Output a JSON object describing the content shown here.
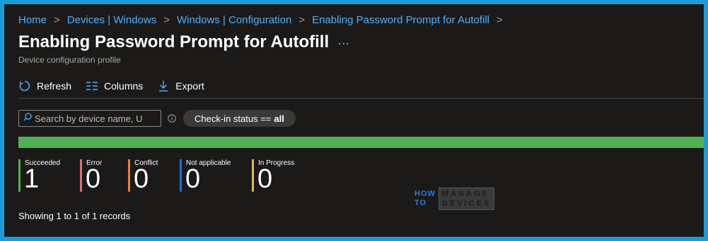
{
  "breadcrumb": {
    "items": [
      "Home",
      "Devices | Windows",
      "Windows | Configuration",
      "Enabling Password Prompt for Autofill"
    ],
    "separator": ">"
  },
  "header": {
    "title": "Enabling Password Prompt for Autofill",
    "more": "...",
    "subtitle": "Device configuration profile"
  },
  "toolbar": {
    "refresh_label": "Refresh",
    "columns_label": "Columns",
    "export_label": "Export"
  },
  "filters": {
    "search_placeholder": "Search by device name, U",
    "search_value": "",
    "checkin_prefix": "Check-in status ==",
    "checkin_value": "all"
  },
  "progress": {
    "succeeded_fraction": 1.0,
    "color": "#54b054"
  },
  "stats": [
    {
      "label": "Succeeded",
      "value": "1",
      "color": "#54b054"
    },
    {
      "label": "Error",
      "value": "0",
      "color": "#e06c75"
    },
    {
      "label": "Conflict",
      "value": "0",
      "color": "#ef7d34"
    },
    {
      "label": "Not applicable",
      "value": "0",
      "color": "#1f6fd1"
    },
    {
      "label": "In Progress",
      "value": "0",
      "color": "#d9b861"
    }
  ],
  "footer": {
    "records_text": "Showing 1 to 1 of 1 records"
  },
  "watermark": {
    "how": "HOW",
    "to": "TO",
    "manage": "MANAGE",
    "devices": "DEVICES"
  }
}
